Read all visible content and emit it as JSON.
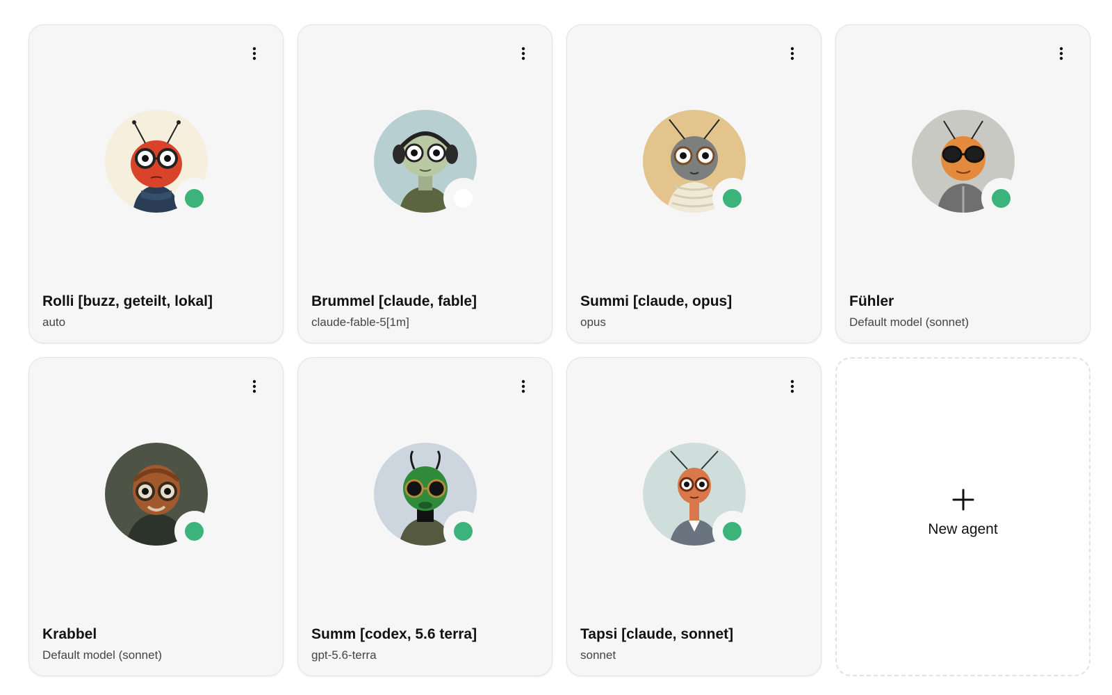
{
  "agents": [
    {
      "name": "Rolli [buzz, geteilt, lokal]",
      "model": "auto",
      "avatar_icon": "ladybug-with-glasses-icon",
      "avatar_bg": "#f6efdd",
      "creature_color": "#d9432a",
      "status_color": "#3bb37a",
      "status": "online"
    },
    {
      "name": "Brummel [claude, fable]",
      "model": "claude-fable-5[1m]",
      "avatar_icon": "mantis-with-headphones-icon",
      "avatar_bg": "#b8cfd2",
      "creature_color": "#b9c9a4",
      "status_color": "#ffffff",
      "status": "offline"
    },
    {
      "name": "Summi [claude, opus]",
      "model": "opus",
      "avatar_icon": "fly-with-turtleneck-icon",
      "avatar_bg": "#e3c48c",
      "creature_color": "#7d7f7f",
      "status_color": "#3bb37a",
      "status": "online"
    },
    {
      "name": "Fühler",
      "model": "Default model (sonnet)",
      "avatar_icon": "ant-with-sunglasses-icon",
      "avatar_bg": "#c9c9c3",
      "creature_color": "#e48a3c",
      "status_color": "#3bb37a",
      "status": "online"
    },
    {
      "name": "Krabbel",
      "model": "Default model (sonnet)",
      "avatar_icon": "beetle-with-goggles-icon",
      "avatar_bg": "#4d5446",
      "creature_color": "#a3592e",
      "status_color": "#3bb37a",
      "status": "online"
    },
    {
      "name": "Summ [codex, 5.6 terra]",
      "model": "gpt-5.6-terra",
      "avatar_icon": "green-alien-bug-icon",
      "avatar_bg": "#cdd5de",
      "creature_color": "#2f8a3a",
      "status_color": "#3bb37a",
      "status": "online"
    },
    {
      "name": "Tapsi [claude, sonnet]",
      "model": "sonnet",
      "avatar_icon": "ant-with-shirt-icon",
      "avatar_bg": "#cfdedb",
      "creature_color": "#d9784a",
      "status_color": "#3bb37a",
      "status": "online"
    }
  ],
  "new_agent": {
    "label": "New agent",
    "icon": "plus-icon"
  },
  "menu_icon": "more-vertical-icon"
}
